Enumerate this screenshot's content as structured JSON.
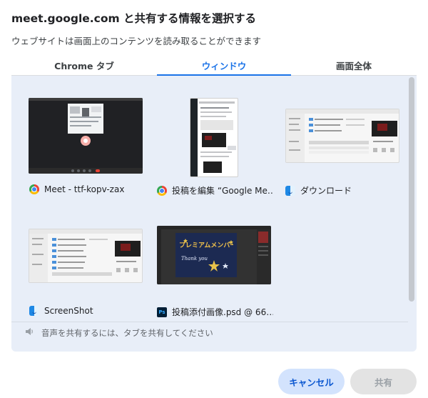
{
  "dialog": {
    "title": "meet.google.com と共有する情報を選択する",
    "subtitle": "ウェブサイトは画面上のコンテンツを読み取ることができます"
  },
  "tabs": [
    {
      "label": "Chrome タブ",
      "active": false
    },
    {
      "label": "ウィンドウ",
      "active": true
    },
    {
      "label": "画面全体",
      "active": false
    }
  ],
  "windows": [
    {
      "label": "Meet - ttf-kopv-zax",
      "icon": "chrome-icon"
    },
    {
      "label": "投稿を編集 “Google Me…",
      "icon": "chrome-icon"
    },
    {
      "label": "ダウンロード",
      "icon": "finder-icon"
    },
    {
      "label": "ScreenShot",
      "icon": "finder-icon"
    },
    {
      "label": "投稿添付画像.psd @ 66…",
      "icon": "photoshop-icon",
      "icon_text": "Ps"
    }
  ],
  "thumbnail_text": {
    "banner": "プレミアムメンバー",
    "script": "Thank you"
  },
  "audio_note": "音声を共有するには、タブを共有してください",
  "buttons": {
    "cancel": "キャンセル",
    "share": "共有"
  },
  "colors": {
    "accent": "#1a73e8",
    "panel": "#e8eef8",
    "cancel_bg": "#d3e3fd",
    "share_disabled_bg": "#e3e3e3"
  }
}
